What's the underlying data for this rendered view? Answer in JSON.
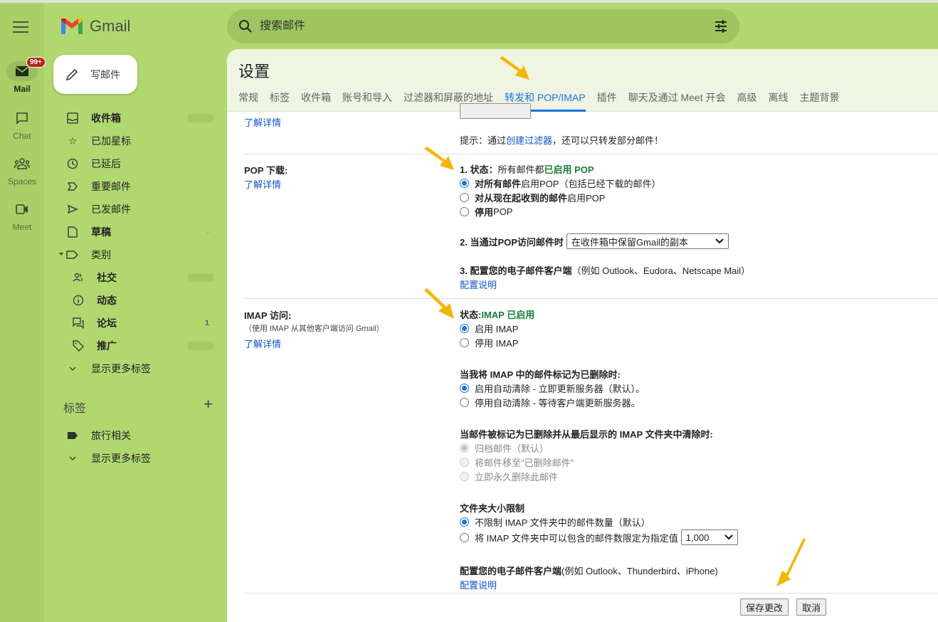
{
  "rail": {
    "items": [
      {
        "label": "Mail",
        "icon": "mail-icon",
        "badge": "99+"
      },
      {
        "label": "Chat",
        "icon": "chat-icon"
      },
      {
        "label": "Spaces",
        "icon": "spaces-icon"
      },
      {
        "label": "Meet",
        "icon": "meet-icon"
      }
    ]
  },
  "app": {
    "name": "Gmail"
  },
  "compose": {
    "label": "写邮件"
  },
  "search": {
    "placeholder": "搜索邮件"
  },
  "nav": {
    "items": [
      {
        "label": "收件箱",
        "icon": "inbox-icon",
        "bold": true
      },
      {
        "label": "已加星标",
        "icon": "star-icon"
      },
      {
        "label": "已延后",
        "icon": "clock-icon"
      },
      {
        "label": "重要邮件",
        "icon": "important-icon"
      },
      {
        "label": "已发邮件",
        "icon": "send-icon"
      },
      {
        "label": "草稿",
        "icon": "draft-icon",
        "bold": true
      },
      {
        "label": "类别",
        "icon": "label-icon"
      },
      {
        "label": "社交",
        "icon": "people-icon",
        "bold": true
      },
      {
        "label": "动态",
        "icon": "info-icon",
        "bold": true
      },
      {
        "label": "论坛",
        "icon": "forum-icon",
        "bold": true,
        "count": "1"
      },
      {
        "label": "推广",
        "icon": "tag-icon",
        "bold": true
      },
      {
        "label": "显示更多标签",
        "icon": "chevron-down-icon"
      }
    ],
    "labels_heading": "标签",
    "labels": [
      {
        "label": "旅行相关",
        "icon": "label-filled-icon"
      },
      {
        "label": "显示更多标签",
        "icon": "chevron-down-icon"
      }
    ]
  },
  "settings": {
    "title": "设置",
    "tabs": [
      "常规",
      "标签",
      "收件箱",
      "账号和导入",
      "过滤器和屏蔽的地址",
      "转发和 POP/IMAP",
      "插件",
      "聊天及通过 Meet 开会",
      "高级",
      "离线",
      "主题背景"
    ],
    "active_tab": "转发和 POP/IMAP",
    "forwarding": {
      "learn_more": "了解详情",
      "tip_prefix": "提示：通过",
      "tip_link": "创建过滤器",
      "tip_suffix": "，还可以只转发部分邮件！"
    },
    "pop": {
      "label": "POP 下载:",
      "learn_more": "了解详情",
      "status_prefix": "1. 状态：",
      "status_mid": " 所有邮件都",
      "status_value": "已启用 POP",
      "options": [
        {
          "bold": "对所有邮件",
          "text": "启用POP（包括已经下载的邮件）",
          "checked": true
        },
        {
          "bold": "对从现在起收到的邮件",
          "text": "启用POP",
          "checked": false
        },
        {
          "bold": "停用",
          "text": "POP",
          "checked": false
        }
      ],
      "access_label": "2. 当通过POP访问邮件时",
      "access_value": "在收件箱中保留Gmail的副本",
      "client_label": "3. 配置您的电子邮件客户端",
      "client_examples": "（例如 Outlook、Eudora、Netscape Mail）",
      "config_link": "配置说明"
    },
    "imap": {
      "label": "IMAP 访问:",
      "sublabel": "（使用 IMAP 从其他客户端访问 Gmail）",
      "learn_more": "了解详情",
      "status_prefix": "状态: ",
      "status_value": "IMAP 已启用",
      "options": [
        {
          "text": "启用 IMAP",
          "checked": true
        },
        {
          "text": "停用 IMAP",
          "checked": false
        }
      ],
      "delete_heading": "当我将 IMAP 中的邮件标记为已删除时:",
      "delete_options": [
        {
          "text": "启用自动清除 - 立即更新服务器（默认）。",
          "checked": true
        },
        {
          "text": "停用自动清除 - 等待客户端更新服务器。",
          "checked": false
        }
      ],
      "expunge_heading": "当邮件被标记为已删除并从最后显示的 IMAP 文件夹中清除时:",
      "expunge_options": [
        {
          "text": "归档邮件（默认）",
          "checked": true,
          "disabled": true
        },
        {
          "text": "将邮件移至\"已删除邮件\"",
          "checked": false,
          "disabled": true
        },
        {
          "text": "立即永久删除此邮件",
          "checked": false,
          "disabled": true
        }
      ],
      "folder_heading": "文件夹大小限制",
      "folder_options": [
        {
          "text": "不限制 IMAP 文件夹中的邮件数量（默认）",
          "checked": true
        },
        {
          "text": "将 IMAP 文件夹中可以包含的邮件数限定为指定值",
          "checked": false
        }
      ],
      "folder_limit_value": "1,000",
      "client_label": "配置您的电子邮件客户端",
      "client_examples": " (例如 Outlook、Thunderbird、iPhone)",
      "config_link": "配置说明"
    },
    "save_label": "保存更改",
    "cancel_label": "取消"
  },
  "colors": {
    "accent": "#1a73e8",
    "status_green": "#188038",
    "annotation_arrow": "#f5b400",
    "theme_green": "#b1d86f"
  }
}
